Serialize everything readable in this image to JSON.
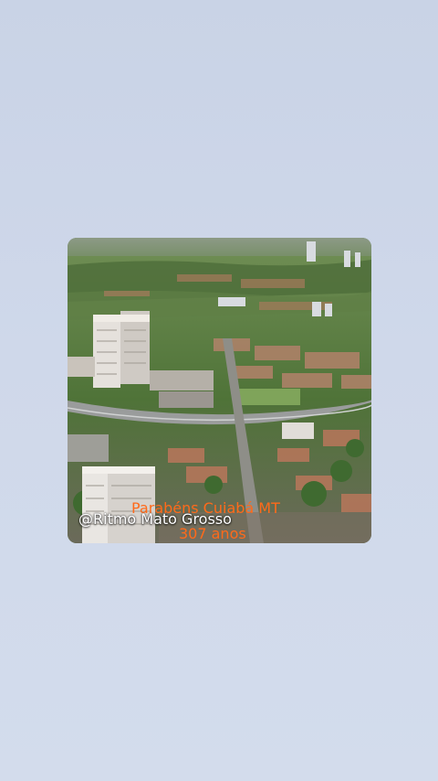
{
  "post": {
    "title": "Parabéns Cuiabá MT",
    "handle": "@Ritmo Mato Grosso",
    "subtitle": "307 anos"
  },
  "colors": {
    "background": "#cfd8ea",
    "caption_orange": "#ff6a1a",
    "caption_white": "#ffffff"
  }
}
